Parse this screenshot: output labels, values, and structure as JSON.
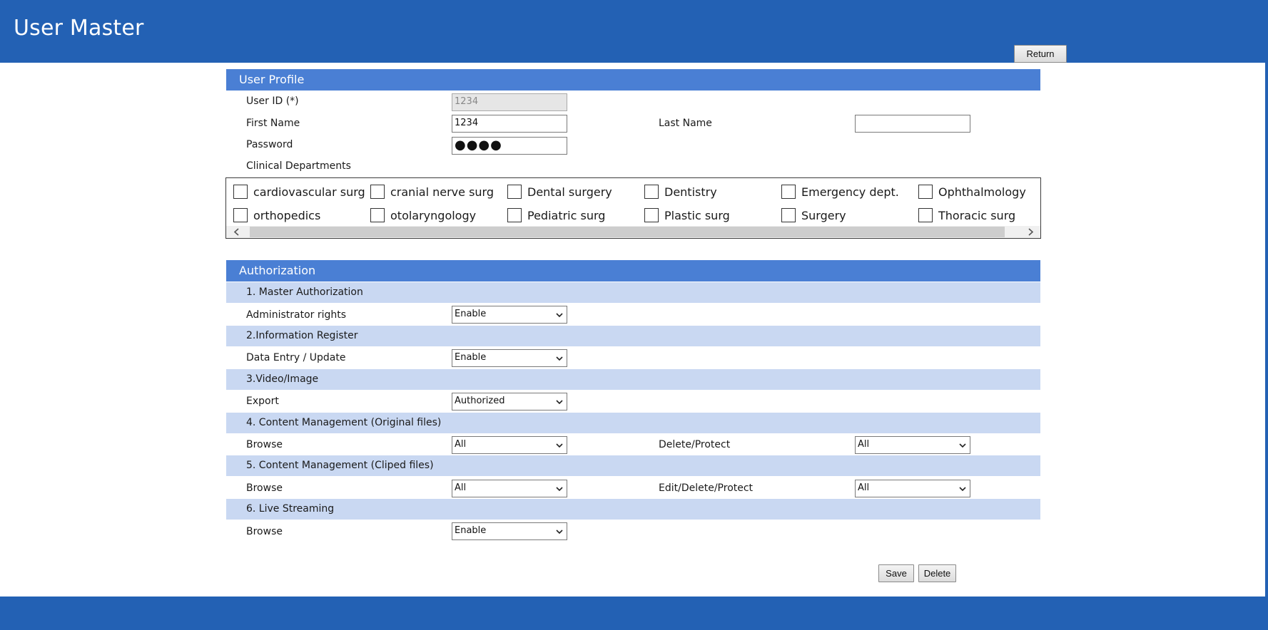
{
  "header": {
    "title": "User Master",
    "return_label": "Return"
  },
  "profile": {
    "section_title": "User Profile",
    "user_id_label": "User ID (*)",
    "user_id_value": "1234",
    "first_name_label": "First Name",
    "first_name_value": "1234",
    "last_name_label": "Last Name",
    "last_name_value": "",
    "password_label": "Password",
    "password_value": "●●●●",
    "departments_label": "Clinical Departments",
    "departments": [
      "cardiovascular surg",
      "cranial nerve surg",
      "Dental surgery",
      "Dentistry",
      "Emergency dept.",
      "Ophthalmology",
      "orthopedics",
      "otolaryngology",
      "Pediatric surg",
      "Plastic surg",
      "Surgery",
      "Thoracic surg"
    ]
  },
  "authorization": {
    "section_title": "Authorization",
    "groups": [
      {
        "title": "1. Master Authorization",
        "row_label": "Administrator rights",
        "value": "Enable"
      },
      {
        "title": "2.Information Register",
        "row_label": "Data Entry / Update",
        "value": "Enable"
      },
      {
        "title": "3.Video/Image",
        "row_label": "Export",
        "value": "Authorized"
      },
      {
        "title": "4. Content Management (Original files)",
        "row_label": "Browse",
        "value": "All",
        "row_label_2": "Delete/Protect",
        "value_2": "All"
      },
      {
        "title": "5. Content Management (Cliped files)",
        "row_label": "Browse",
        "value": "All",
        "row_label_2": "Edit/Delete/Protect",
        "value_2": "All"
      },
      {
        "title": "6. Live Streaming",
        "row_label": "Browse",
        "value": "Enable"
      }
    ]
  },
  "actions": {
    "save_label": "Save",
    "delete_label": "Delete"
  },
  "colors": {
    "header": "#2361b4",
    "section": "#4a7fd4",
    "subsection": "#c9d8f2"
  }
}
